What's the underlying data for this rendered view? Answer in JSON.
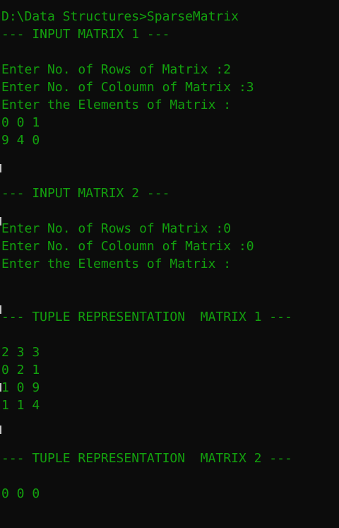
{
  "colors": {
    "background": "#0c0c0c",
    "text": "#13a10e"
  },
  "console": {
    "lines": [
      "D:\\Data Structures>SparseMatrix",
      "--- INPUT MATRIX 1 ---",
      "",
      "Enter No. of Rows of Matrix :2",
      "Enter No. of Coloumn of Matrix :3",
      "Enter the Elements of Matrix :",
      "0 0 1",
      "9 4 0",
      "",
      "",
      "--- INPUT MATRIX 2 ---",
      "",
      "Enter No. of Rows of Matrix :0",
      "Enter No. of Coloumn of Matrix :0",
      "Enter the Elements of Matrix :",
      "",
      "",
      "--- TUPLE REPRESENTATION  MATRIX 1 ---",
      "",
      "2 3 3",
      "0 2 1",
      "1 0 9",
      "1 1 4",
      "",
      "",
      "--- TUPLE REPRESENTATION  MATRIX 2 ---",
      "",
      "0 0 0"
    ]
  }
}
